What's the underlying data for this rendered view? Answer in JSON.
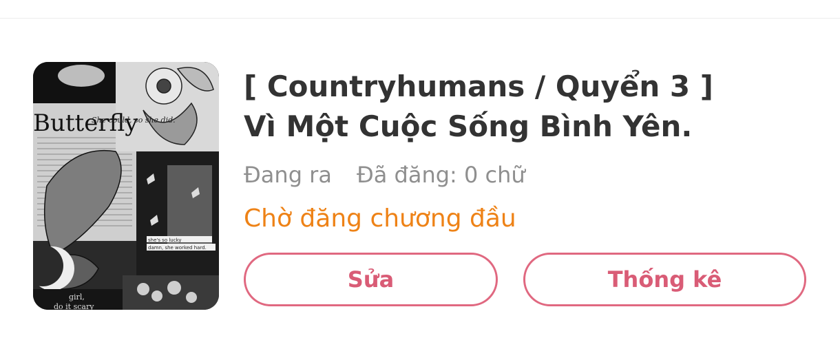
{
  "book": {
    "title_line1": "[ Countryhumans / Quyển 3 ]",
    "title_line2": "Vì Một Cuộc Sống Bình Yên.",
    "status": "Đang ra",
    "posted": "Đã đăng: 0 chữ",
    "pending_note": "Chờ đăng chương đầu",
    "cover": {
      "headline": "Butterfly",
      "quote": "She could, so she did.",
      "note_line1": "she's so lucky",
      "note_line2": "damn, she worked hard.",
      "footer_line1": "girl,",
      "footer_line2": "do it scary"
    }
  },
  "actions": {
    "edit_label": "Sửa",
    "stats_label": "Thống kê"
  },
  "colors": {
    "title": "#333333",
    "meta": "#8f8f8f",
    "pending": "#ee8216",
    "accent": "#e06880"
  }
}
